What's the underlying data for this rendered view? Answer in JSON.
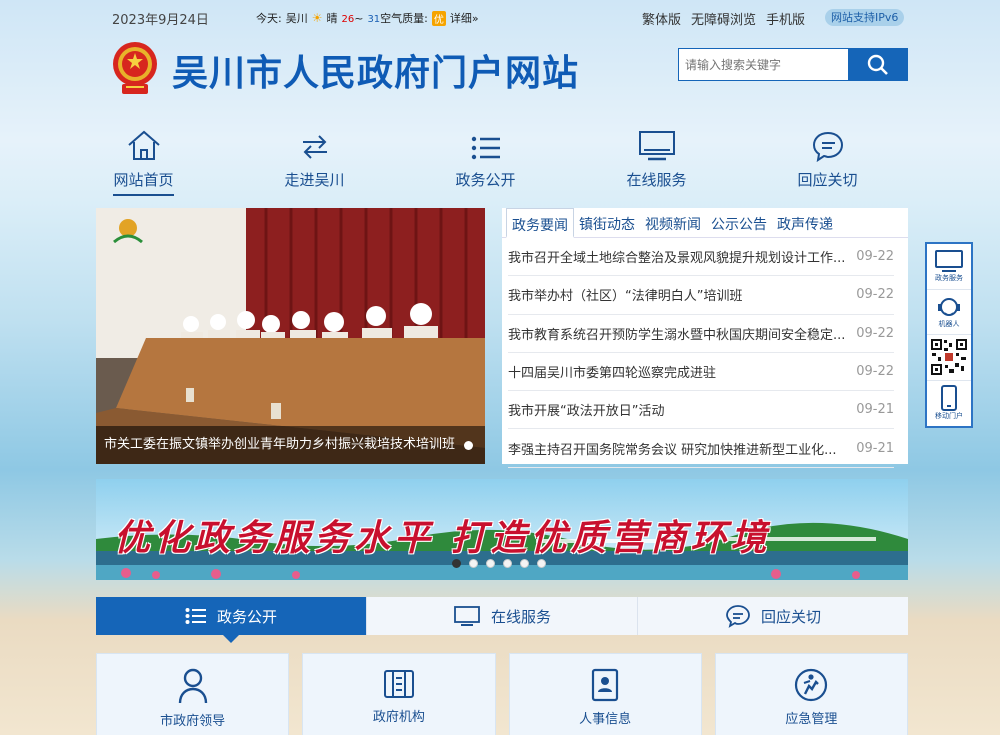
{
  "topbar": {
    "date": "2023年9月24日",
    "weather_label": "今天:",
    "city": "吴川",
    "condition": "晴",
    "temp_high": "26",
    "temp_sep": "~",
    "temp_low": "31",
    "aq_label": "空气质量:",
    "aq_value": "优",
    "aq_detail": "详细»",
    "links": [
      "繁体版",
      "无障碍浏览",
      "手机版"
    ],
    "ipv6": "网站支持IPv6"
  },
  "header": {
    "title": "吴川市人民政府门户网站",
    "search_placeholder": "请输入搜索关键字"
  },
  "nav": [
    {
      "label": "网站首页",
      "icon": "home-icon"
    },
    {
      "label": "走进吴川",
      "icon": "arrows-icon"
    },
    {
      "label": "政务公开",
      "icon": "list-icon"
    },
    {
      "label": "在线服务",
      "icon": "monitor-icon"
    },
    {
      "label": "回应关切",
      "icon": "chat-icon"
    }
  ],
  "slide": {
    "caption": "市关工委在振文镇举办创业青年助力乡村振兴栽培技术培训班"
  },
  "news": {
    "tabs": [
      "政务要闻",
      "镇街动态",
      "视频新闻",
      "公示公告",
      "政声传递"
    ],
    "items": [
      {
        "title": "我市召开全域土地综合整治及景观风貌提升规划设计工作...",
        "date": "09-22"
      },
      {
        "title": "我市举办村（社区）“法律明白人”培训班",
        "date": "09-22"
      },
      {
        "title": "我市教育系统召开预防学生溺水暨中秋国庆期间安全稳定...",
        "date": "09-22"
      },
      {
        "title": "十四届吴川市委第四轮巡察完成进驻",
        "date": "09-22"
      },
      {
        "title": "我市开展“政法开放日”活动",
        "date": "09-21"
      },
      {
        "title": "李强主持召开国务院常务会议 研究加快推进新型工业化...",
        "date": "09-21"
      }
    ]
  },
  "sidefloat": [
    "政务服务",
    "机器人",
    "",
    "移动门户"
  ],
  "banner": {
    "text": "优化政务服务水平 打造优质营商环境",
    "dots": 6,
    "active_dot": 0
  },
  "sections": [
    {
      "label": "政务公开",
      "icon": "list-icon"
    },
    {
      "label": "在线服务",
      "icon": "monitor-icon"
    },
    {
      "label": "回应关切",
      "icon": "chat-icon"
    }
  ],
  "cards": [
    {
      "label": "市政府领导",
      "icon": "person-icon"
    },
    {
      "label": "政府机构",
      "icon": "building-icon"
    },
    {
      "label": "人事信息",
      "icon": "document-icon"
    },
    {
      "label": "应急管理",
      "icon": "emergency-icon"
    }
  ],
  "colors": {
    "primary": "#1565b8",
    "title": "#0f5bb5",
    "banner_red": "#c8102e"
  }
}
